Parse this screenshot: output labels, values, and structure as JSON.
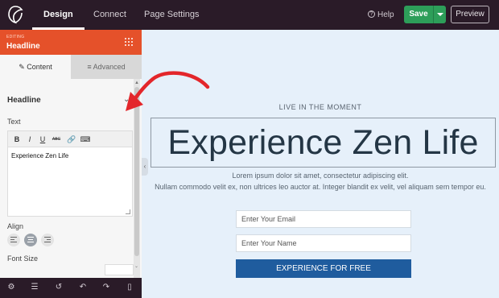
{
  "topbar": {
    "tabs": [
      {
        "label": "Design",
        "active": true
      },
      {
        "label": "Connect",
        "active": false
      },
      {
        "label": "Page Settings",
        "active": false
      }
    ],
    "help_label": "Help",
    "save_label": "Save",
    "preview_label": "Preview"
  },
  "sidebar": {
    "editing_label": "EDITING",
    "element_title": "Headline",
    "tabs": [
      {
        "label": "Content",
        "icon": "pencil-icon"
      },
      {
        "label": "Advanced",
        "icon": "sliders-icon"
      }
    ],
    "section_title": "Headline",
    "text_label": "Text",
    "editor_text": "Experience Zen Life",
    "align_label": "Align",
    "font_size_label": "Font Size",
    "toolbar_buttons": [
      "B",
      "I",
      "U",
      "ABC"
    ]
  },
  "canvas": {
    "tagline": "LIVE IN THE MOMENT",
    "headline": "Experience Zen Life",
    "body_line1": "Lorem ipsum dolor sit amet, consectetur adipiscing elit.",
    "body_line2": "Nullam commodo velit ex, non ultrices leo auctor at. Integer blandit ex velit, vel aliquam sem tempor eu.",
    "email_placeholder": "Enter Your Email",
    "name_placeholder": "Enter Your Name",
    "cta_label": "EXPERIENCE FOR FREE"
  },
  "colors": {
    "topbar": "#2a1b28",
    "save_green": "#2d9e59",
    "edit_header_orange": "#e5512a",
    "cta_blue": "#1f5c9e",
    "annotation_red": "#e3262b"
  }
}
